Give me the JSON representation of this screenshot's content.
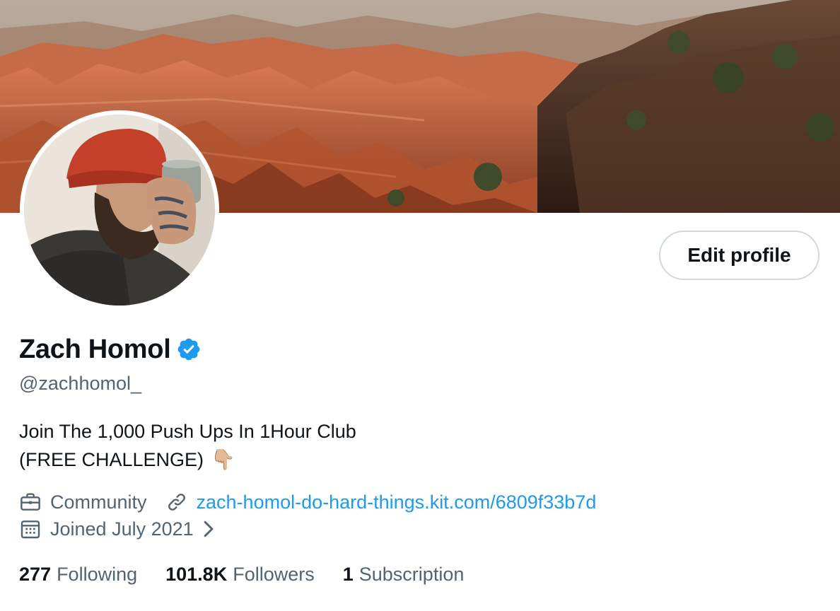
{
  "profile": {
    "display_name": "Zach Homol",
    "handle": "@zachhomol_",
    "verified": true,
    "edit_button_label": "Edit profile",
    "bio_line1": "Join The 1,000 Push Ups In 1Hour Club",
    "bio_line2": "(FREE CHALLENGE)",
    "bio_emoji": "👇🏼",
    "category": "Community",
    "link": "zach-homol-do-hard-things.kit.com/6809f33b7d",
    "joined": "Joined July 2021"
  },
  "stats": [
    {
      "number": "277",
      "label": "Following"
    },
    {
      "number": "101.8K",
      "label": "Followers"
    },
    {
      "number": "1",
      "label": "Subscription"
    }
  ],
  "icons": {
    "verified": "verified-badge-icon",
    "category": "briefcase-icon",
    "link": "link-icon",
    "joined": "calendar-icon",
    "chevron": "chevron-right-icon"
  },
  "colors": {
    "accent": "#1d9bf0",
    "text_primary": "#0f1419",
    "text_secondary": "#536471",
    "button_border": "#cfd9de"
  }
}
